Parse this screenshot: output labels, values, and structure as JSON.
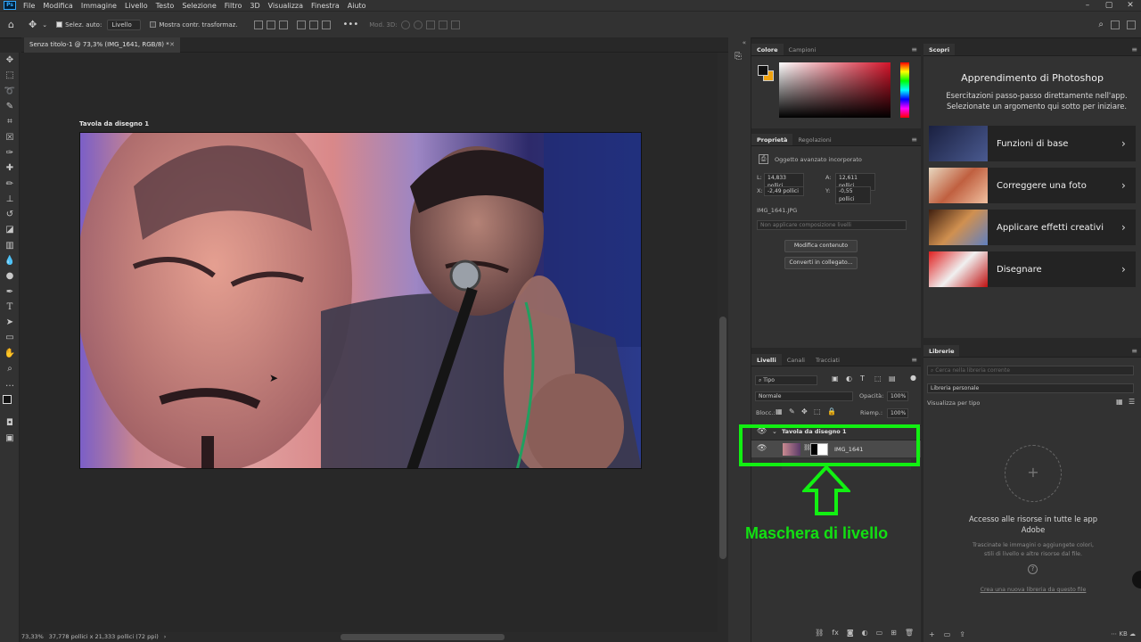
{
  "menubar": {
    "app_icon": "Ps",
    "items": [
      "File",
      "Modifica",
      "Immagine",
      "Livello",
      "Testo",
      "Selezione",
      "Filtro",
      "3D",
      "Visualizza",
      "Finestra",
      "Aiuto"
    ]
  },
  "options_bar": {
    "auto_select_label": "Selez. auto:",
    "auto_select_value": "Livello",
    "transform_label": "Mostra contr. trasformaz.",
    "mode_3d": "Mod. 3D:"
  },
  "document": {
    "tab_title": "Senza titolo-1 @ 73,3% (IMG_1641, RGB/8) *",
    "artboard_label": "Tavola da disegno 1"
  },
  "status": {
    "zoom": "73,33%",
    "size": "37,778 pollici x 21,333 pollici (72 ppi)"
  },
  "color_panel": {
    "tabs": [
      "Colore",
      "Campioni"
    ],
    "foreground": "#111111",
    "background": "#f0a20e"
  },
  "properties_panel": {
    "tabs": [
      "Proprietà",
      "Regolazioni"
    ],
    "type": "Oggetto avanzato incorporato",
    "w_label": "L:",
    "w_value": "14,833 pollici",
    "h_label": "A:",
    "h_value": "12,611 pollici",
    "x_label": "X:",
    "x_value": "-2,49 pollici",
    "y_label": "Y:",
    "y_value": "-0,55 pollici",
    "file": "IMG_1641.JPG",
    "comp_placeholder": "Non applicare composizione livelli",
    "edit_button": "Modifica contenuto",
    "convert_button": "Converti in collegato..."
  },
  "layers_panel": {
    "tabs": [
      "Livelli",
      "Canali",
      "Tracciati"
    ],
    "filter_kind": "Tipo",
    "blend_mode": "Normale",
    "opacity_label": "Opacità:",
    "opacity_value": "100%",
    "lock_label": "Blocc.:",
    "fill_label": "Riemp.:",
    "fill_value": "100%",
    "artboard_layer": "Tavola da disegno 1",
    "image_layer": "IMG_1641"
  },
  "annotation": {
    "text": "Maschera di livello",
    "color": "#12e012"
  },
  "learn_panel": {
    "tab": "Scopri",
    "title": "Apprendimento di Photoshop",
    "subtitle": "Esercitazioni passo-passo direttamente nell'app. Selezionate un argomento qui sotto per iniziare.",
    "cards": [
      "Funzioni di base",
      "Correggere una foto",
      "Applicare effetti creativi",
      "Disegnare"
    ]
  },
  "libraries_panel": {
    "tab": "Librerie",
    "search_placeholder": "Cerca nella libreria corrente",
    "library": "Libreria personale",
    "view_label": "Visualizza per tipo",
    "access_text": "Accesso alle risorse in tutte le app Adobe",
    "hint": "Trascinate le immagini o aggiungete colori, stili di livello e altre risorse dal file.",
    "create_link": "Crea una nuova libreria da questo file"
  }
}
